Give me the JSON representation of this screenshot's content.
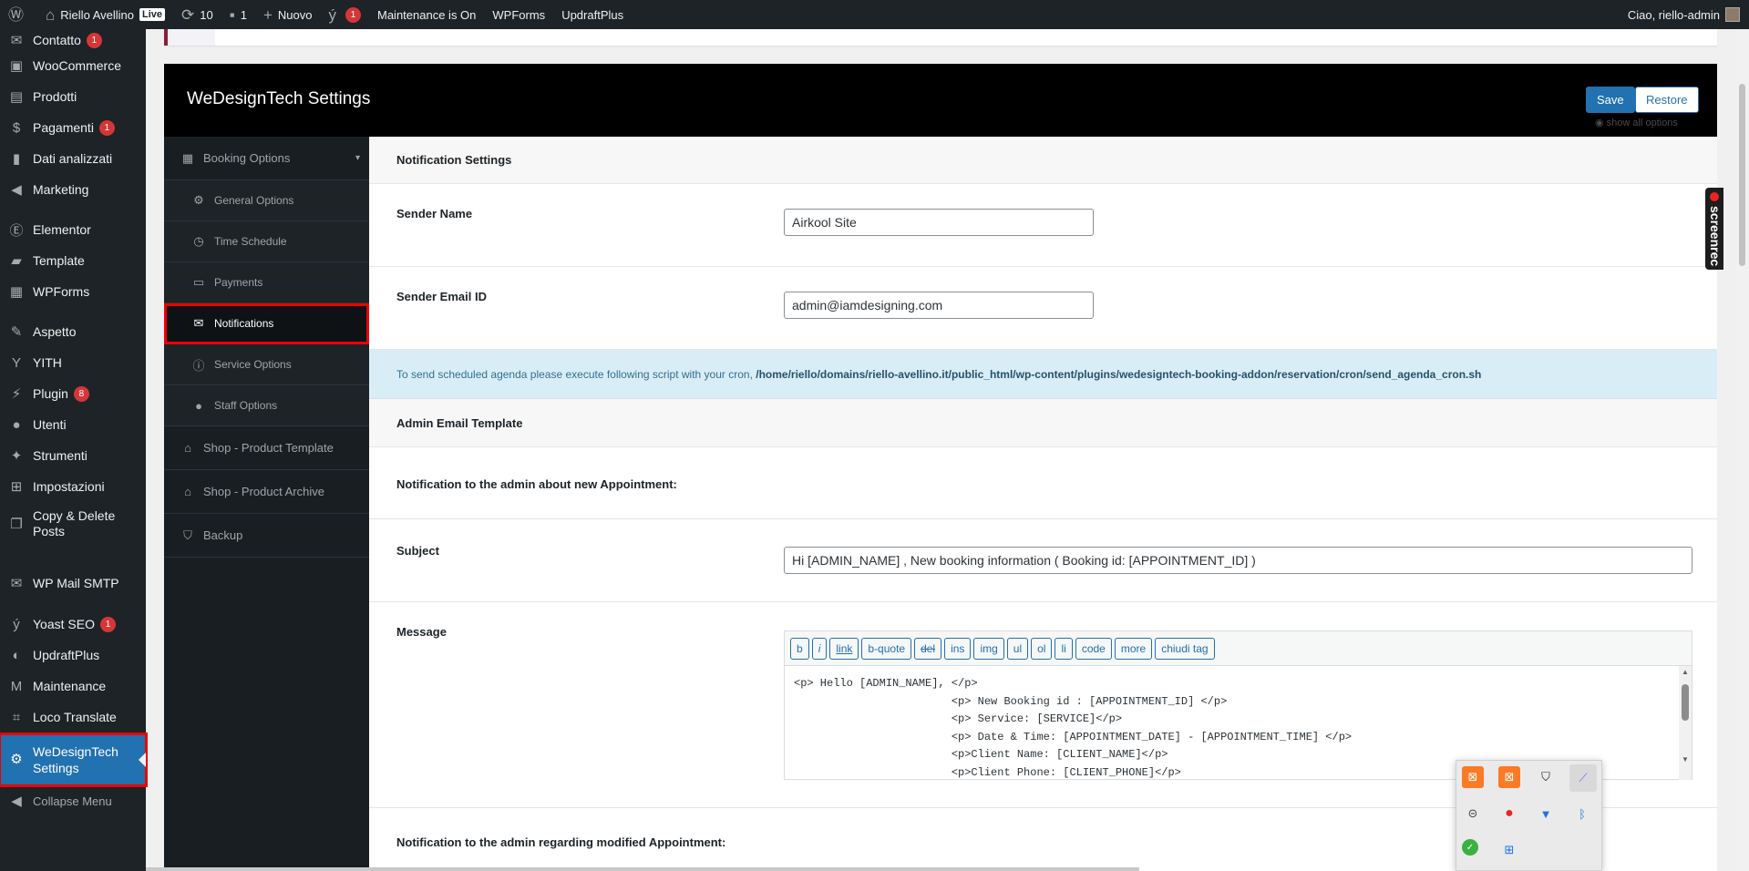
{
  "adminbar": {
    "site_name": "Riello Avellino",
    "live": "Live",
    "updates": "10",
    "comments": "1",
    "new": "Nuovo",
    "yoast_count": "1",
    "maintenance": "Maintenance is On",
    "wpforms": "WPForms",
    "updraft": "UpdraftPlus",
    "greeting": "Ciao, riello-admin"
  },
  "menu": [
    {
      "label": "Contatto",
      "icon": "envelope-icon",
      "count": "1"
    },
    {
      "label": "WooCommerce",
      "icon": "woo-icon"
    },
    {
      "label": "Prodotti",
      "icon": "archive-icon"
    },
    {
      "label": "Pagamenti",
      "icon": "dollar-icon",
      "count": "1"
    },
    {
      "label": "Dati analizzati",
      "icon": "chart-icon"
    },
    {
      "label": "Marketing",
      "icon": "megaphone-icon"
    },
    {
      "label": "Elementor",
      "icon": "elementor-icon"
    },
    {
      "label": "Template",
      "icon": "folder-icon"
    },
    {
      "label": "WPForms",
      "icon": "form-icon"
    },
    {
      "label": "Aspetto",
      "icon": "brush-icon"
    },
    {
      "label": "YITH",
      "icon": "yith-icon"
    },
    {
      "label": "Plugin",
      "icon": "plugin-icon",
      "count": "8"
    },
    {
      "label": "Utenti",
      "icon": "user-icon"
    },
    {
      "label": "Strumenti",
      "icon": "wrench-icon"
    },
    {
      "label": "Impostazioni",
      "icon": "settings-icon"
    },
    {
      "label": "Copy & Delete Posts",
      "icon": "copy-icon"
    },
    {
      "label": "WP Mail SMTP",
      "icon": "mail-icon"
    },
    {
      "label": "Yoast SEO",
      "icon": "yoast-icon",
      "count": "1"
    },
    {
      "label": "UpdraftPlus",
      "icon": "updraft-icon"
    },
    {
      "label": "Maintenance",
      "icon": "maintenance-icon"
    },
    {
      "label": "Loco Translate",
      "icon": "translate-icon"
    },
    {
      "label": "WeDesignTech Settings",
      "icon": "gear-icon"
    },
    {
      "label": "Collapse Menu",
      "icon": "collapse-icon"
    }
  ],
  "header": {
    "title": "WeDesignTech Settings",
    "save": "Save",
    "restore": "Restore",
    "show_all": "show all options"
  },
  "sidebar": {
    "booking": "Booking Options",
    "subs": [
      "General Options",
      "Time Schedule",
      "Payments",
      "Notifications",
      "Service Options",
      "Staff Options"
    ],
    "shop_template": "Shop - Product Template",
    "shop_archive": "Shop - Product Archive",
    "backup": "Backup"
  },
  "main": {
    "section_title": "Notification Settings",
    "sender_name_label": "Sender Name",
    "sender_name_value": "Airkool Site",
    "sender_email_label": "Sender Email ID",
    "sender_email_value": "admin@iamdesigning.com",
    "info_text": "To send scheduled agenda please execute following script with your cron, ",
    "info_path": "/home/riello/domains/riello-avellino.it/public_html/wp-content/plugins/wedesigntech-booking-addon/reservation/cron/send_agenda_cron.sh",
    "admin_template_title": "Admin Email Template",
    "notif_new": "Notification to the admin about new Appointment:",
    "subject_label": "Subject",
    "subject_value": "Hi [ADMIN_NAME] , New booking information ( Booking id: [APPOINTMENT_ID] )",
    "message_label": "Message",
    "toolbar": [
      "b",
      "i",
      "link",
      "b-quote",
      "del",
      "ins",
      "img",
      "ul",
      "ol",
      "li",
      "code",
      "more",
      "chiudi tag"
    ],
    "message_lines": [
      "<p> Hello [ADMIN_NAME], </p>",
      "                        <p> New Booking id : [APPOINTMENT_ID] </p>",
      "                        <p> Service: [SERVICE]</p>",
      "                        <p> Date & Time: [APPOINTMENT_DATE] - [APPOINTMENT_TIME] </p>",
      "                        <p>Client Name: [CLIENT_NAME]</p>",
      "                        <p>Client Phone: [CLIENT_PHONE]</p>"
    ],
    "notif_modified": "Notification to the admin regarding modified Appointment:"
  },
  "screenrec": "screenrec"
}
